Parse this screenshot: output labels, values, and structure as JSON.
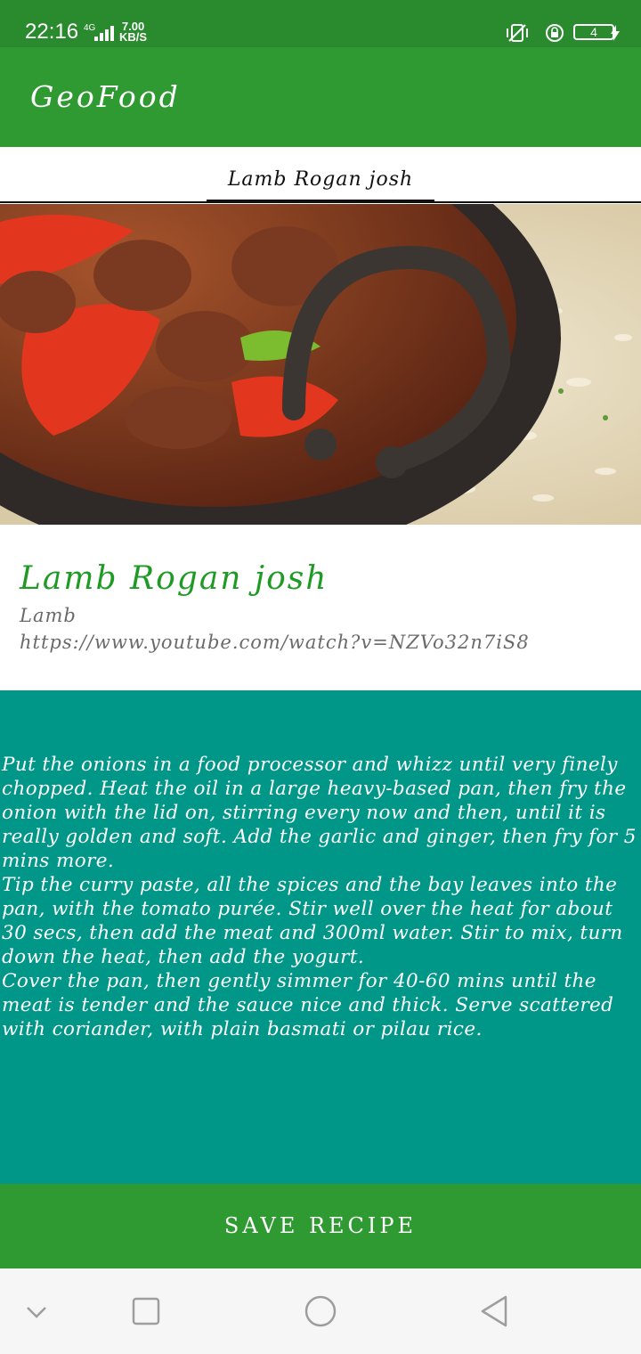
{
  "status_bar": {
    "time": "22:16",
    "network": "4G",
    "speed_value": "7.00",
    "speed_unit": "KB/S",
    "battery_level": "4"
  },
  "app_bar": {
    "title": "GeoFood"
  },
  "tabs": [
    {
      "label": "Lamb Rogan josh",
      "selected": true
    }
  ],
  "recipe": {
    "title": "Lamb Rogan josh",
    "category": "Lamb",
    "video_link": "https://www.youtube.com/watch?v=NZVo32n7iS8",
    "instructions": [
      "Put the onions in a food processor and whizz until very finely chopped. Heat the oil in a large heavy-based pan, then fry the onion with the lid on, stirring every now and then, until it is really golden and soft. Add the garlic and ginger, then fry for 5 mins more.",
      "Tip the curry paste, all the spices and the bay leaves into the pan, with the tomato purée. Stir well over the heat for about 30 secs, then add the meat and 300ml water. Stir to mix, turn down the heat, then add the yogurt.",
      "Cover the pan, then gently simmer for 40-60 mins until the meat is tender and the sauce nice and thick. Serve scattered with coriander, with plain basmati or pilau rice."
    ]
  },
  "actions": {
    "save_label": "SAVE RECIPE"
  },
  "colors": {
    "app_bar": "#2e9a31",
    "title_green": "#1f9a25",
    "instructions_bg": "#009688"
  },
  "icons": {
    "nav_down": "chevron-down-icon",
    "nav_recents": "square-icon",
    "nav_home": "circle-icon",
    "nav_back": "triangle-back-icon"
  }
}
